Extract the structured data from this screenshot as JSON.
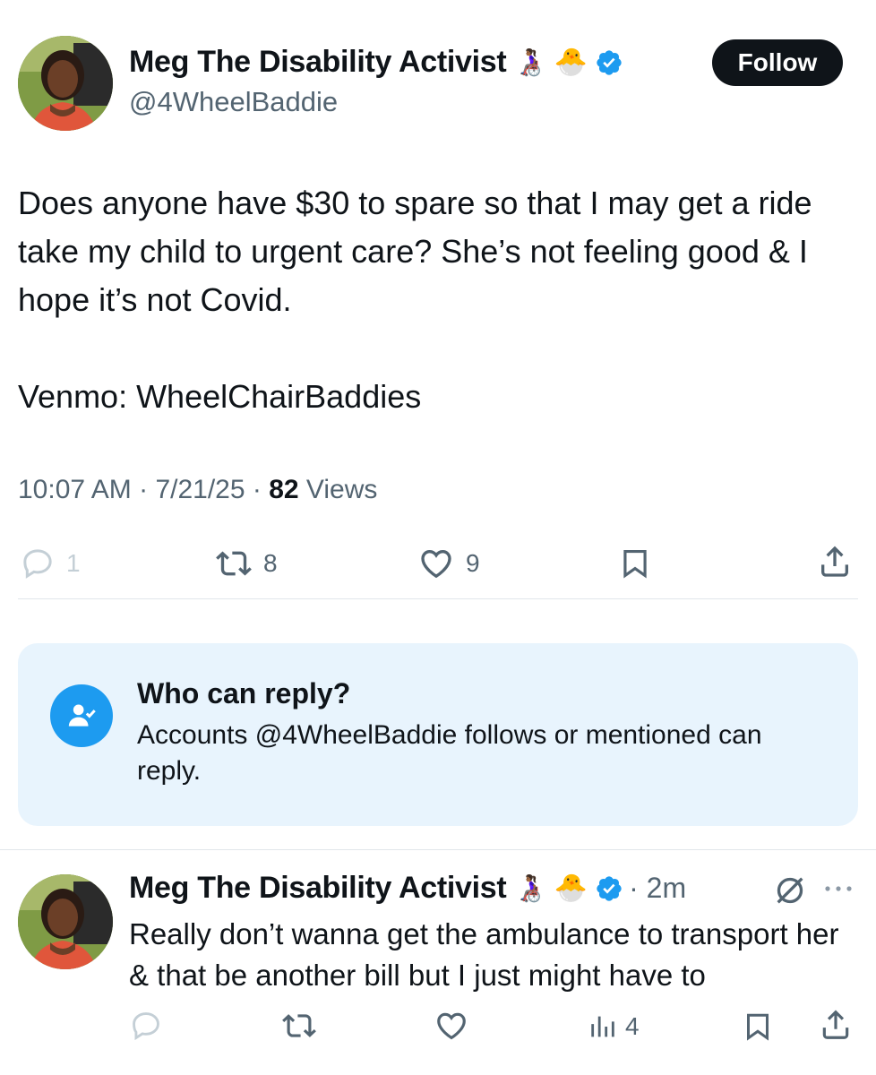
{
  "tweet": {
    "author": {
      "display_name": "Meg The Disability Activist",
      "emojis": [
        "👩🏾‍🦽",
        "🐣"
      ],
      "handle": "@4WheelBaddie",
      "verified_icon": "verified-badge-icon"
    },
    "follow_label": "Follow",
    "text": "Does anyone have $30 to spare so that I may get a ride take my child to urgent care? She’s not feeling good & I hope it’s not Covid.\n\nVenmo: WheelChairBaddies",
    "time": "10:07 AM",
    "sep1": " · ",
    "date": "7/21/25",
    "sep2": " · ",
    "views_count": "82",
    "views_label": " Views",
    "actions": {
      "reply_count": "1",
      "retweet_count": "8",
      "like_count": "9"
    }
  },
  "who_can_reply": {
    "title": "Who can reply?",
    "description": "Accounts @4WheelBaddie follows or mentioned can reply."
  },
  "reply": {
    "author": {
      "display_name": "Meg The Disability Activist",
      "emojis": [
        "👩🏾‍🦽",
        "🐣"
      ]
    },
    "time_ago": "· 2m",
    "text": "Really don’t wanna get the ambulance to transport her & that be another bill but I just might have to",
    "views_count": "4"
  },
  "colors": {
    "accent": "#1d9bf0",
    "text": "#0f1419",
    "muted": "#536471",
    "reply_box_bg": "#e8f4fd",
    "follow_bg": "#0f1419"
  }
}
